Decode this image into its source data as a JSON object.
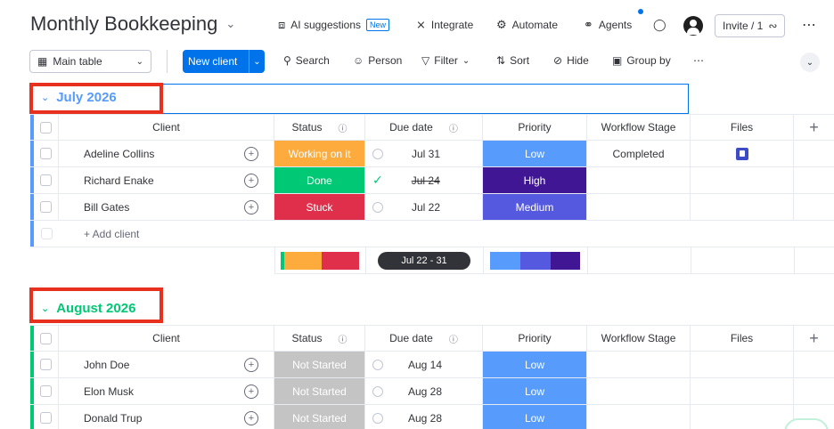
{
  "header": {
    "title": "Monthly Bookkeeping",
    "ai_suggestions": "AI suggestions",
    "new_badge": "New",
    "integrate": "Integrate",
    "automate": "Automate",
    "agents": "Agents",
    "invite": "Invite / 1"
  },
  "toolbar": {
    "main_table": "Main table",
    "new_client": "New client",
    "search": "Search",
    "person": "Person",
    "filter": "Filter",
    "sort": "Sort",
    "hide": "Hide",
    "group_by": "Group by"
  },
  "columns": {
    "client": "Client",
    "status": "Status",
    "due_date": "Due date",
    "priority": "Priority",
    "workflow_stage": "Workflow Stage",
    "files": "Files"
  },
  "colors": {
    "accent": "#0073ea",
    "working": "#fdab3d",
    "done": "#00c875",
    "stuck": "#df2f4a",
    "not_started": "#c4c4c4",
    "low": "#579bfc",
    "medium": "#5559df",
    "high": "#401694",
    "highlight": "#e8301f"
  },
  "groups": [
    {
      "name": "July 2026",
      "rows": [
        {
          "client": "Adeline Collins",
          "status": "Working on it",
          "due": "Jul 31",
          "priority": "Low",
          "workflow": "Completed"
        },
        {
          "client": "Richard Enake",
          "status": "Done",
          "due": "Jul 24",
          "priority": "High",
          "workflow": ""
        },
        {
          "client": "Bill Gates",
          "status": "Stuck",
          "due": "Jul 22",
          "priority": "Medium",
          "workflow": ""
        }
      ],
      "add_label": "+ Add client",
      "summary_range": "Jul 22 - 31"
    },
    {
      "name": "August 2026",
      "rows": [
        {
          "client": "John Doe",
          "status": "Not Started",
          "due": "Aug 14",
          "priority": "Low",
          "workflow": ""
        },
        {
          "client": "Elon Musk",
          "status": "Not Started",
          "due": "Aug 28",
          "priority": "Low",
          "workflow": ""
        },
        {
          "client": "Donald Trup",
          "status": "Not Started",
          "due": "Aug 28",
          "priority": "Low",
          "workflow": ""
        }
      ]
    }
  ]
}
